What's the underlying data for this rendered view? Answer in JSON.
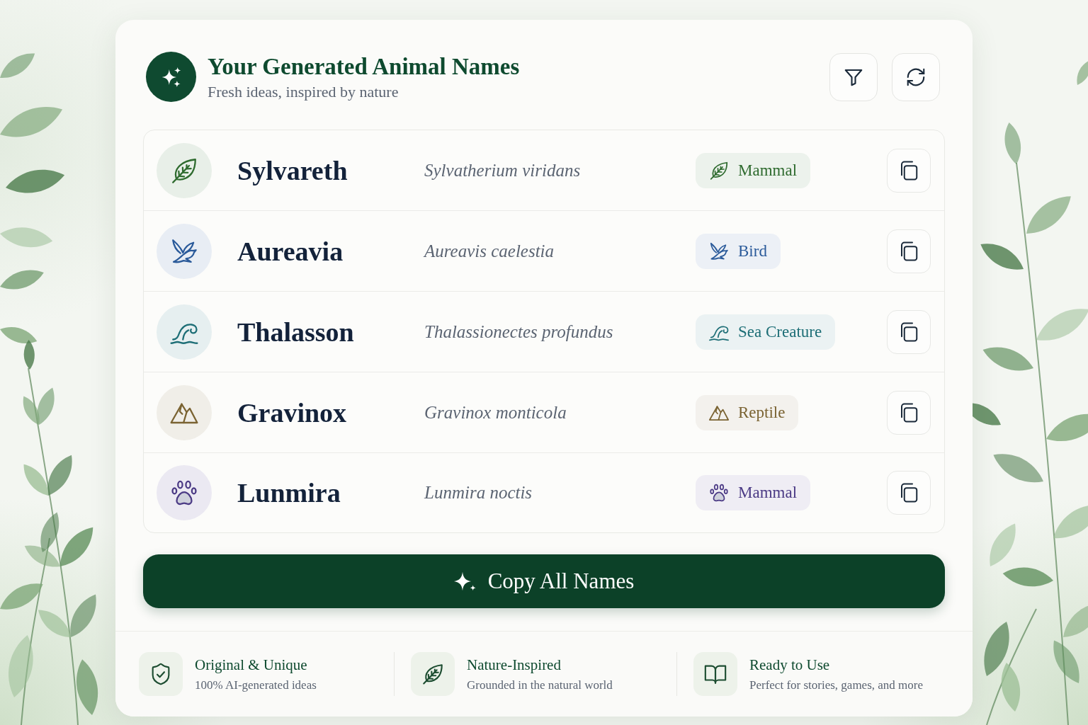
{
  "header": {
    "title": "Your Generated Animal Names",
    "subtitle": "Fresh ideas, inspired by nature"
  },
  "names": [
    {
      "name": "Sylvareth",
      "scientific_name": "Sylvatherium viridans",
      "category": "Mammal",
      "kind": "leaf",
      "color": "#2f6b2f"
    },
    {
      "name": "Aureavia",
      "scientific_name": "Aureavis caelestia",
      "category": "Bird",
      "kind": "bird",
      "color": "#2a5a9a"
    },
    {
      "name": "Thalasson",
      "scientific_name": "Thalassionectes profundus",
      "category": "Sea Creature",
      "kind": "wave",
      "color": "#1d6e76"
    },
    {
      "name": "Gravinox",
      "scientific_name": "Gravinox monticola",
      "category": "Reptile",
      "kind": "mountain",
      "color": "#7a6332"
    },
    {
      "name": "Lunmira",
      "scientific_name": "Lunmira noctis",
      "category": "Mammal",
      "kind": "paw",
      "color": "#4b3a85"
    }
  ],
  "primary_action": {
    "label": "Copy All Names"
  },
  "features": [
    {
      "title": "Original & Unique",
      "description": "100% AI-generated ideas",
      "kind": "shield"
    },
    {
      "title": "Nature-Inspired",
      "description": "Grounded in the natural world",
      "kind": "leaf"
    },
    {
      "title": "Ready to Use",
      "description": "Perfect for stories, games, and more",
      "kind": "book"
    }
  ]
}
